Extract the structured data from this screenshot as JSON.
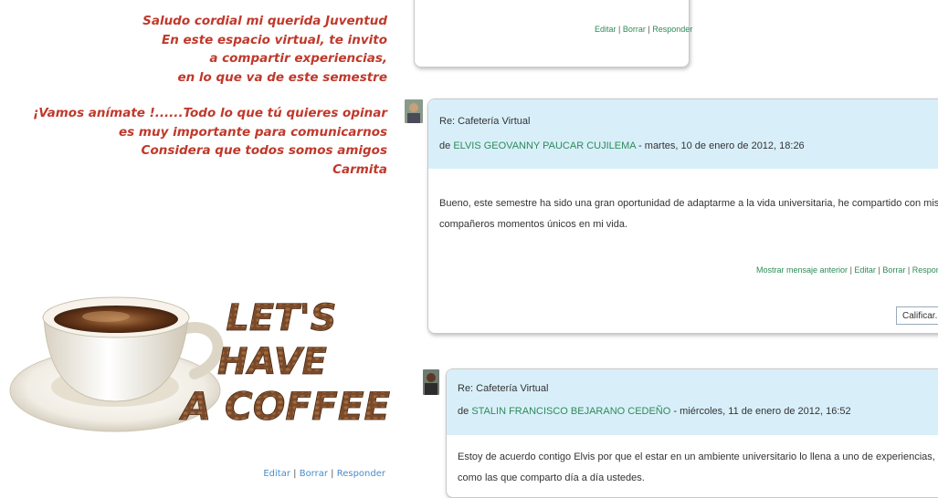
{
  "intro": {
    "lines_a": [
      "Saludo cordial mi querida Juventud",
      "En este espacio virtual, te invito",
      "a compartir experiencias,",
      "en lo que va de este semestre"
    ],
    "lines_b": [
      "¡Vamos anímate !......Todo lo que tú quieres opinar",
      "es muy importante para comunicarnos",
      "Considera que todos somos amigos",
      "Carmita"
    ]
  },
  "coffee_image": {
    "text_lines": [
      "LET'S",
      "HAVE",
      "A COFFEE"
    ]
  },
  "left_actions": {
    "edit": "Editar",
    "delete": "Borrar",
    "reply": "Responder",
    "separator": "|"
  },
  "top_post": {
    "edit": "Editar",
    "delete": "Borrar",
    "reply": "Responder",
    "separator": "|"
  },
  "posts": [
    {
      "title": "Re: Cafetería Virtual",
      "by": "de",
      "author": "ELVIS GEOVANNY PAUCAR CUJILEMA",
      "date": " - martes, 10 de enero de 2012, 18:26",
      "body": "Bueno, este semestre ha sido una gran oportunidad de adaptarme a la vida universitaria, he compartido con mis compañeros momentos únicos en mi vida.",
      "commands": {
        "show_parent": "Mostrar mensaje anterior",
        "edit": "Editar",
        "delete": "Borrar",
        "reply": "Responder",
        "separator": "|"
      },
      "rate_select": {
        "value": "Calificar...",
        "arrow": "▼"
      }
    },
    {
      "title": "Re: Cafetería Virtual",
      "by": "de",
      "author": "STALIN FRANCISCO BEJARANO CEDEÑO",
      "date": " - miércoles, 11 de enero de 2012, 16:52",
      "body": "Estoy de acuerdo contigo Elvis por que el estar en un ambiente universitario lo llena a uno de experiencias, como las que comparto día a día ustedes."
    }
  ],
  "colors": {
    "intro_text": "#c0392b",
    "header_bg": "#d8effa",
    "author_link": "#2e8b57",
    "left_link": "#4a8cc9"
  }
}
